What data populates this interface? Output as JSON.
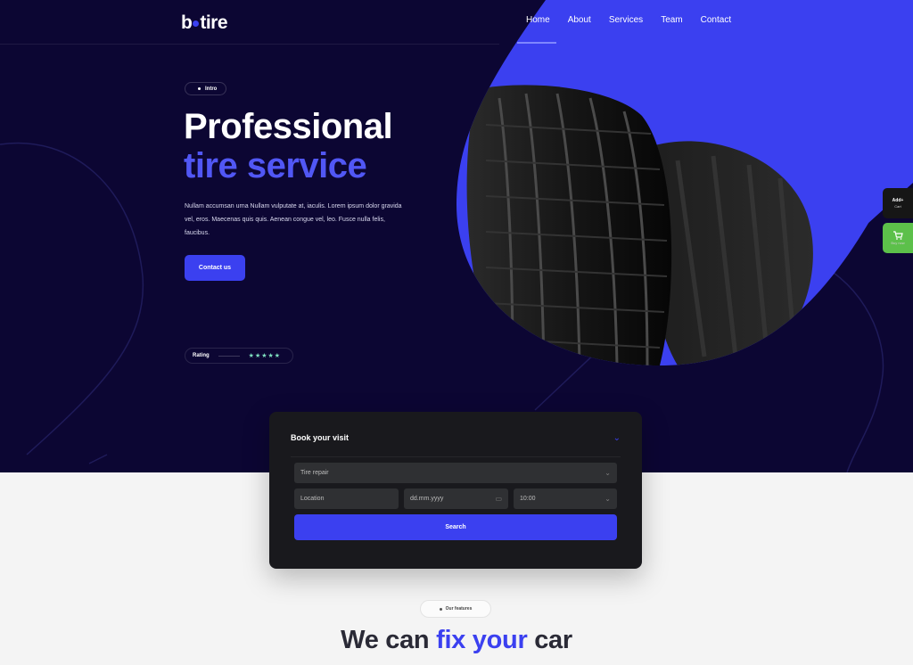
{
  "brand": {
    "name_left": "b",
    "name_right": "tire"
  },
  "nav": {
    "items": [
      {
        "label": "Home"
      },
      {
        "label": "About"
      },
      {
        "label": "Services"
      },
      {
        "label": "Team"
      },
      {
        "label": "Contact"
      }
    ]
  },
  "hero": {
    "pill": "Intro",
    "title_line1": "Professional",
    "title_line2": "tire service",
    "description": "Nullam accumsan urna Nullam vulputate at, iaculis. Lorem ipsum dolor gravida vel, eros. Maecenas quis quis. Aenean congue vel, leo. Fusce nulla felis, faucibus.",
    "cta": "Contact us",
    "rating_label": "Rating",
    "stars": "★★★★★"
  },
  "side_tabs": {
    "dark": {
      "title": "Add+",
      "subtitle": "Cart"
    },
    "green": {
      "subtitle": "Buy now"
    }
  },
  "booking": {
    "title": "Book your visit",
    "service": "Tire repair",
    "location": "Location",
    "date": "dd.mm.yyyy",
    "time": "10:00",
    "search": "Search"
  },
  "features": {
    "pill": "Our features",
    "headline_a": "We can ",
    "headline_b": "fix your",
    "headline_c": " car"
  },
  "colors": {
    "hero_bg": "#0c0633",
    "accent": "#3b40f0",
    "accent_light": "#5157f5",
    "green": "#5cc04a"
  }
}
